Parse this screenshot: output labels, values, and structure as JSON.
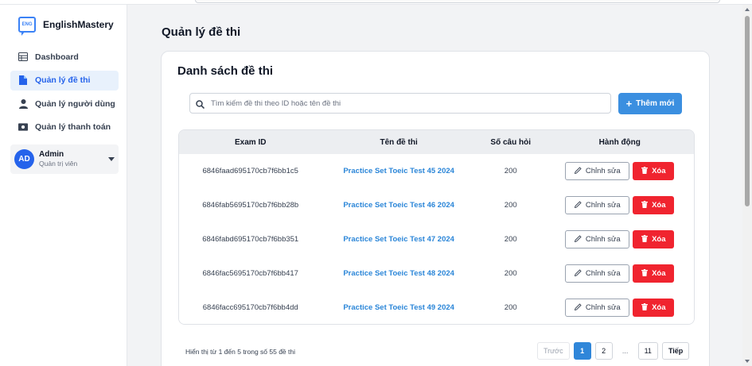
{
  "brand": {
    "name": "EnglishMastery",
    "logo_text": "ENG"
  },
  "sidebar": {
    "items": [
      {
        "label": "Dashboard",
        "icon": "table-icon",
        "active": false
      },
      {
        "label": "Quản lý đề thi",
        "icon": "document-icon",
        "active": true
      },
      {
        "label": "Quản lý người dùng",
        "icon": "user-icon",
        "active": false
      },
      {
        "label": "Quản lý thanh toán",
        "icon": "money-icon",
        "active": false
      }
    ],
    "user": {
      "initials": "AD",
      "name": "Admin",
      "role": "Quản trị viên"
    }
  },
  "page": {
    "title": "Quản lý đề thi"
  },
  "card": {
    "title": "Danh sách đề thi",
    "search_placeholder": "Tìm kiếm đề thi theo ID hoặc tên đề thi",
    "add_label": "Thêm mới"
  },
  "table": {
    "headers": [
      "Exam ID",
      "Tên đề thi",
      "Số câu hỏi",
      "Hành động"
    ],
    "rows": [
      {
        "id": "6846faad695170cb7f6bb1c5",
        "name": "Practice Set Toeic Test 45 2024",
        "count": "200"
      },
      {
        "id": "6846fab5695170cb7f6bb28b",
        "name": "Practice Set Toeic Test 46 2024",
        "count": "200"
      },
      {
        "id": "6846fabd695170cb7f6bb351",
        "name": "Practice Set Toeic Test 47 2024",
        "count": "200"
      },
      {
        "id": "6846fac5695170cb7f6bb417",
        "name": "Practice Set Toeic Test 48 2024",
        "count": "200"
      },
      {
        "id": "6846facc695170cb7f6bb4dd",
        "name": "Practice Set Toeic Test 49 2024",
        "count": "200"
      }
    ],
    "edit_label": "Chỉnh sửa",
    "delete_label": "Xóa"
  },
  "footer": {
    "summary": "Hiển thị từ 1 đến 5 trong số 55 đề thi"
  },
  "pagination": {
    "prev": "Trước",
    "pages": [
      "1",
      "2",
      "...",
      "11"
    ],
    "current": "1",
    "next": "Tiếp"
  },
  "colors": {
    "primary": "#2f86d9",
    "danger": "#f0242f",
    "link": "#2b86d8",
    "active_bg": "#e8f1fc"
  }
}
